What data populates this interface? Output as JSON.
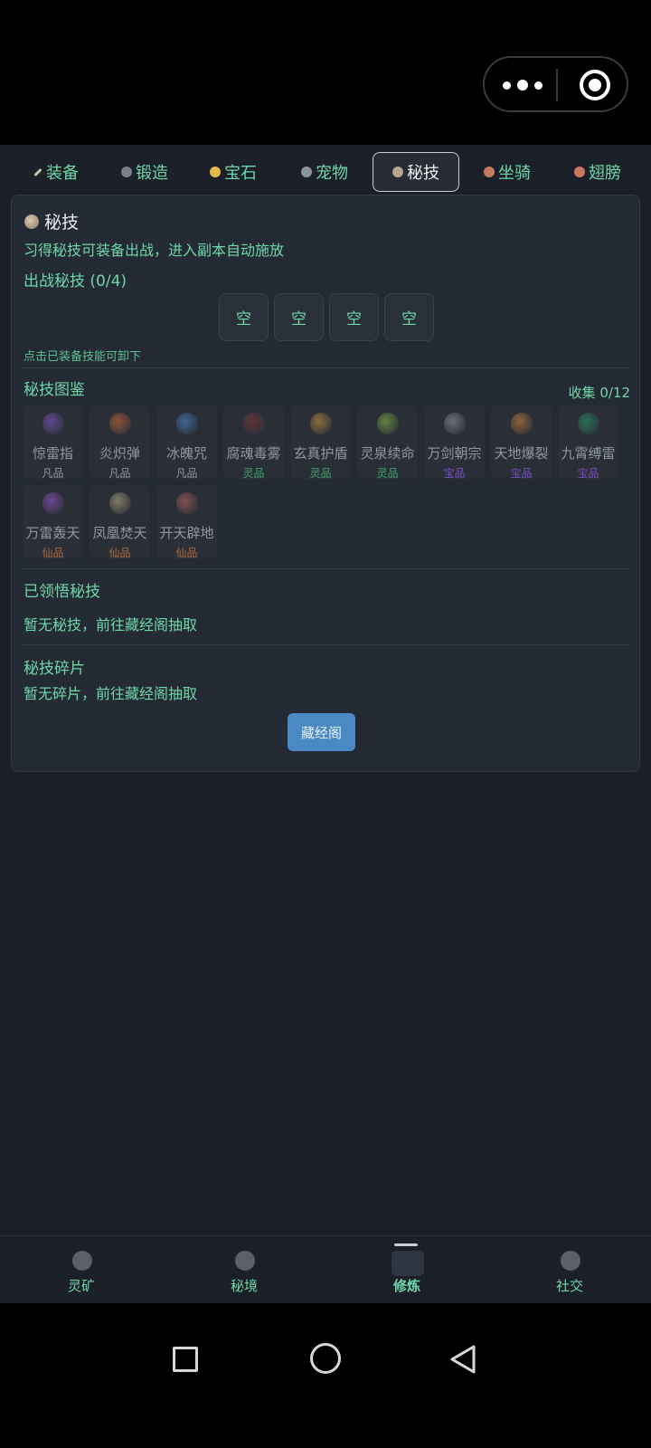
{
  "capsule": {
    "more_icon": "ellipsis-icon",
    "close_icon": "target-icon"
  },
  "tabs": [
    {
      "label": "装备",
      "icon_color": "#c9c2a8",
      "active": false
    },
    {
      "label": "锻造",
      "icon_color": "#7b8088",
      "active": false
    },
    {
      "label": "宝石",
      "icon_color": "#e6b84a",
      "active": false
    },
    {
      "label": "宠物",
      "icon_color": "#8a949c",
      "active": false
    },
    {
      "label": "秘技",
      "icon_color": "#b6a590",
      "active": true
    },
    {
      "label": "坐骑",
      "icon_color": "#c77b5e",
      "active": false
    },
    {
      "label": "翅膀",
      "icon_color": "#c77b5e",
      "active": false
    }
  ],
  "panel": {
    "title": "秘技",
    "description": "习得秘技可装备出战，进入副本自动施放",
    "battle_title": "出战秘技 (0/4)",
    "slots": [
      "空",
      "空",
      "空",
      "空"
    ],
    "hint": "点击已装备技能可卸下",
    "codex_title": "秘技图鉴",
    "collect": "收集 0/12",
    "codex": [
      {
        "name": "惊雷指",
        "grade": "凡品",
        "grade_color": "#8f979f",
        "icon_color": "#8b5cd6"
      },
      {
        "name": "炎炽弹",
        "grade": "凡品",
        "grade_color": "#8f979f",
        "icon_color": "#e0703a"
      },
      {
        "name": "冰魄咒",
        "grade": "凡品",
        "grade_color": "#8f979f",
        "icon_color": "#4f8fe0"
      },
      {
        "name": "腐魂毒雾",
        "grade": "灵品",
        "grade_color": "#3fa36f",
        "icon_color": "#8a3a3a"
      },
      {
        "name": "玄真护盾",
        "grade": "灵品",
        "grade_color": "#3fa36f",
        "icon_color": "#d6a040"
      },
      {
        "name": "灵泉续命",
        "grade": "灵品",
        "grade_color": "#3fa36f",
        "icon_color": "#8ec34a"
      },
      {
        "name": "万剑朝宗",
        "grade": "宝品",
        "grade_color": "#7a4fc4",
        "icon_color": "#9aa0a8"
      },
      {
        "name": "天地爆裂",
        "grade": "宝品",
        "grade_color": "#7a4fc4",
        "icon_color": "#e08a3a"
      },
      {
        "name": "九霄缚雷",
        "grade": "宝品",
        "grade_color": "#7a4fc4",
        "icon_color": "#2fa070"
      },
      {
        "name": "万雷轰天",
        "grade": "仙品",
        "grade_color": "#b06a3a",
        "icon_color": "#a05ad6"
      },
      {
        "name": "凤凰焚天",
        "grade": "仙品",
        "grade_color": "#b06a3a",
        "icon_color": "#c8b890"
      },
      {
        "name": "开天辟地",
        "grade": "仙品",
        "grade_color": "#b06a3a",
        "icon_color": "#c86a6a"
      }
    ],
    "learned_title": "已领悟秘技",
    "learned_empty": "暂无秘技，前往藏经阁抽取",
    "fragments_title": "秘技碎片",
    "fragments_empty": "暂无碎片，前往藏经阁抽取",
    "button": "藏经阁"
  },
  "bottom_nav": [
    {
      "label": "灵矿",
      "icon": "mine-icon",
      "active": false
    },
    {
      "label": "秘境",
      "icon": "realm-icon",
      "active": false
    },
    {
      "label": "修炼",
      "icon": "meditate-icon",
      "active": true
    },
    {
      "label": "社交",
      "icon": "social-icon",
      "active": false
    }
  ]
}
